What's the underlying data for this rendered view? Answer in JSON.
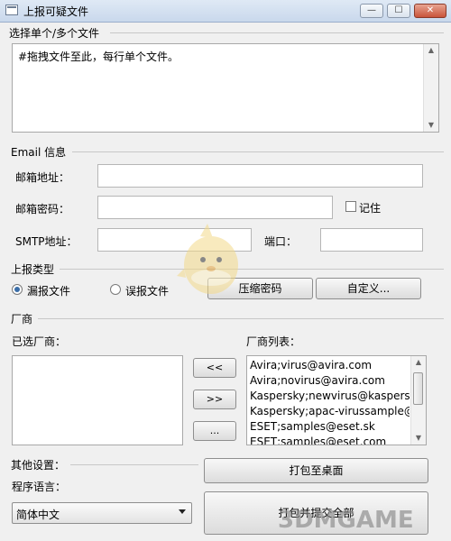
{
  "window": {
    "title": "上报可疑文件"
  },
  "file_section": {
    "label": "选择单个/多个文件",
    "placeholder": "#拖拽文件至此，每行单个文件。"
  },
  "email_section": {
    "label": "Email 信息",
    "address_label": "邮箱地址：",
    "password_label": "邮箱密码：",
    "remember_label": "记住",
    "smtp_label": "SMTP地址：",
    "port_label": "端口："
  },
  "report_section": {
    "label": "上报类型",
    "options": [
      {
        "label": "漏报文件",
        "checked": true
      },
      {
        "label": "误报文件",
        "checked": false
      }
    ],
    "compress_btn": "压缩密码",
    "custom_btn": "自定义..."
  },
  "vendor_section": {
    "label": "厂商",
    "selected_label": "已选厂商：",
    "list_label": "厂商列表：",
    "add_btn": "<<",
    "remove_btn": ">>",
    "more_btn": "...",
    "vendors": [
      "Avira;virus@avira.com",
      "Avira;novirus@avira.com",
      "Kaspersky;newvirus@kaspersky.com",
      "Kaspersky;apac-virussample@kaspersky.com",
      "ESET;samples@eset.sk",
      "ESET;samples@eset.com"
    ]
  },
  "other_section": {
    "label": "其他设置：",
    "lang_label": "程序语言：",
    "lang_value": "简体中文",
    "pack_btn": "打包至桌面",
    "submit_btn": "打包并提交全部"
  },
  "watermark": "3DMGAME"
}
